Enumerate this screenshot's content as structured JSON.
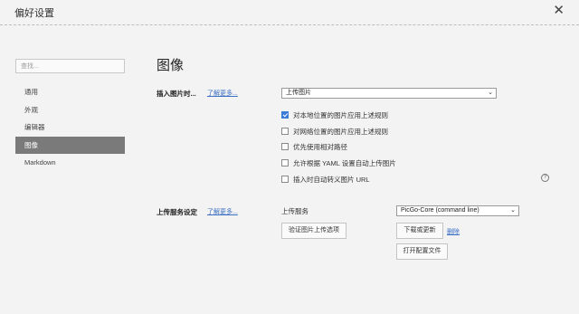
{
  "window": {
    "title": "偏好设置",
    "close_glyph": "✕"
  },
  "sidebar": {
    "search_placeholder": "查找...",
    "items": [
      {
        "label": "通用"
      },
      {
        "label": "外观"
      },
      {
        "label": "编辑器"
      },
      {
        "label": "图像",
        "active": true
      },
      {
        "label": "Markdown"
      }
    ]
  },
  "main": {
    "title": "图像",
    "insert_image": {
      "label": "插入图片时...",
      "learn_more": "了解更多...",
      "select_value": "上传图片",
      "options": [
        {
          "label": "对本地位置的图片应用上述规则",
          "checked": true
        },
        {
          "label": "对网络位置的图片应用上述规则",
          "checked": false
        },
        {
          "label": "优先使用相对路径",
          "checked": false
        },
        {
          "label": "允许根据 YAML 设置自动上传图片",
          "checked": false
        },
        {
          "label": "插入时自动转义图片 URL",
          "checked": false
        }
      ],
      "help_glyph": "?"
    },
    "upload_service": {
      "label": "上传服务设定",
      "learn_more": "了解更多...",
      "service_label": "上传服务",
      "service_value": "PicGo-Core (command line)",
      "verify_button": "验证图片上传选项",
      "download_button": "下载或更新",
      "delete_link": "删除",
      "open_config_button": "打开配置文件"
    }
  },
  "colors": {
    "accent": "#3b7bd8",
    "active_nav_bg": "#7a7a7a",
    "link": "#3a6fc4"
  }
}
